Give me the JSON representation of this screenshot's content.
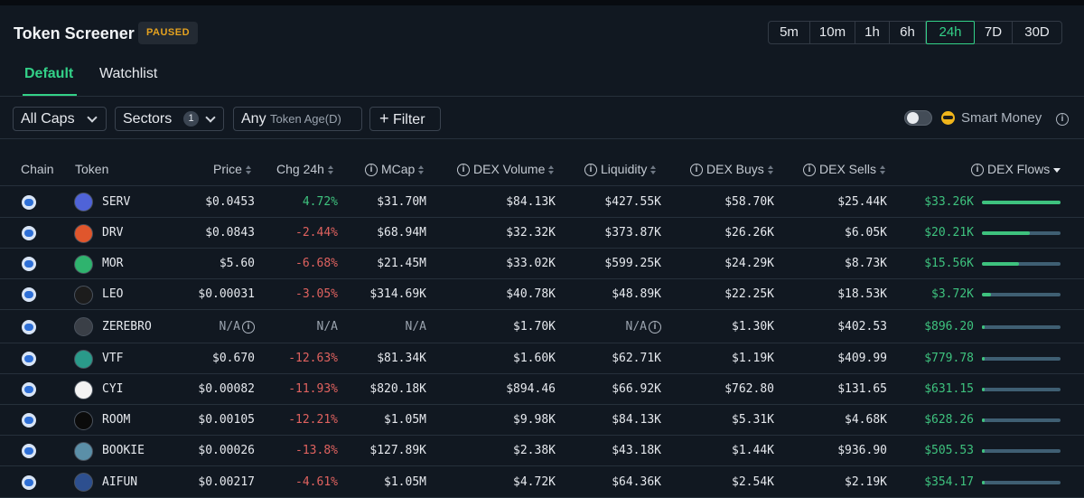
{
  "header": {
    "title": "Token Screener",
    "status_badge": "PAUSED",
    "timeframes": [
      "5m",
      "10m",
      "1h",
      "6h",
      "24h",
      "7D",
      "30D"
    ],
    "active_timeframe": "24h"
  },
  "tabs": [
    {
      "label": "Default",
      "active": true
    },
    {
      "label": "Watchlist",
      "active": false
    }
  ],
  "filters": {
    "caps_label": "All Caps",
    "sectors_label": "Sectors",
    "sectors_count": "1",
    "age_label": "Any",
    "age_placeholder": "Token Age(D)",
    "filter_label": "Filter",
    "filter_icon": "+"
  },
  "smart_money": {
    "label": "Smart Money",
    "enabled": false,
    "icon": "sunglasses-emoji-icon",
    "info_icon": "i"
  },
  "columns": {
    "chain": "Chain",
    "token": "Token",
    "price": "Price",
    "chg": "Chg 24h",
    "mcap": "MCap",
    "dex_volume": "DEX Volume",
    "liquidity": "Liquidity",
    "dex_buys": "DEX Buys",
    "dex_sells": "DEX Sells",
    "dex_flows": "DEX Flows"
  },
  "colors": {
    "accent": "#33d188",
    "positive": "#3ec27e",
    "negative": "#e0625f",
    "paused": "#e5a21f"
  },
  "rows": [
    {
      "symbol": "SERV",
      "price": "$0.0453",
      "chg": "4.72%",
      "dir": "pos",
      "mcap": "$31.70M",
      "volume": "$84.13K",
      "liquidity": "$427.55K",
      "buys": "$58.70K",
      "sells": "$25.44K",
      "flows": "$33.26K",
      "flow_fraction": 1.0,
      "icon_color": "#4f63d8"
    },
    {
      "symbol": "DRV",
      "price": "$0.0843",
      "chg": "-2.44%",
      "dir": "neg",
      "mcap": "$68.94M",
      "volume": "$32.32K",
      "liquidity": "$373.87K",
      "buys": "$26.26K",
      "sells": "$6.05K",
      "flows": "$20.21K",
      "flow_fraction": 0.61,
      "icon_color": "#e0562c"
    },
    {
      "symbol": "MOR",
      "price": "$5.60",
      "chg": "-6.68%",
      "dir": "neg",
      "mcap": "$21.45M",
      "volume": "$33.02K",
      "liquidity": "$599.25K",
      "buys": "$24.29K",
      "sells": "$8.73K",
      "flows": "$15.56K",
      "flow_fraction": 0.47,
      "icon_color": "#2fb36e"
    },
    {
      "symbol": "LEO",
      "price": "$0.00031",
      "chg": "-3.05%",
      "dir": "neg",
      "mcap": "$314.69K",
      "volume": "$40.78K",
      "liquidity": "$48.89K",
      "buys": "$22.25K",
      "sells": "$18.53K",
      "flows": "$3.72K",
      "flow_fraction": 0.11,
      "icon_color": "#1c1c1c"
    },
    {
      "symbol": "ZEREBRO",
      "price": "N/A",
      "chg": "N/A",
      "dir": "na",
      "mcap": "N/A",
      "volume": "$1.70K",
      "liquidity": "N/A",
      "buys": "$1.30K",
      "sells": "$402.53",
      "flows": "$896.20",
      "flow_fraction": 0.03,
      "icon_color": "#3a3f47"
    },
    {
      "symbol": "VTF",
      "price": "$0.670",
      "chg": "-12.63%",
      "dir": "neg",
      "mcap": "$81.34K",
      "volume": "$1.60K",
      "liquidity": "$62.71K",
      "buys": "$1.19K",
      "sells": "$409.99",
      "flows": "$779.78",
      "flow_fraction": 0.02,
      "icon_color": "#2a9a8a"
    },
    {
      "symbol": "CYI",
      "price": "$0.00082",
      "chg": "-11.93%",
      "dir": "neg",
      "mcap": "$820.18K",
      "volume": "$894.46",
      "liquidity": "$66.92K",
      "buys": "$762.80",
      "sells": "$131.65",
      "flows": "$631.15",
      "flow_fraction": 0.02,
      "icon_color": "#f3f3f3"
    },
    {
      "symbol": "ROOM",
      "price": "$0.00105",
      "chg": "-12.21%",
      "dir": "neg",
      "mcap": "$1.05M",
      "volume": "$9.98K",
      "liquidity": "$84.13K",
      "buys": "$5.31K",
      "sells": "$4.68K",
      "flows": "$628.26",
      "flow_fraction": 0.02,
      "icon_color": "#0b0b0b"
    },
    {
      "symbol": "BOOKIE",
      "price": "$0.00026",
      "chg": "-13.8%",
      "dir": "neg",
      "mcap": "$127.89K",
      "volume": "$2.38K",
      "liquidity": "$43.18K",
      "buys": "$1.44K",
      "sells": "$936.90",
      "flows": "$505.53",
      "flow_fraction": 0.01,
      "icon_color": "#5b8fa8"
    },
    {
      "symbol": "AIFUN",
      "price": "$0.00217",
      "chg": "-4.61%",
      "dir": "neg",
      "mcap": "$1.05M",
      "volume": "$4.72K",
      "liquidity": "$64.36K",
      "buys": "$2.54K",
      "sells": "$2.19K",
      "flows": "$354.17",
      "flow_fraction": 0.01,
      "icon_color": "#2d4f8f"
    }
  ]
}
